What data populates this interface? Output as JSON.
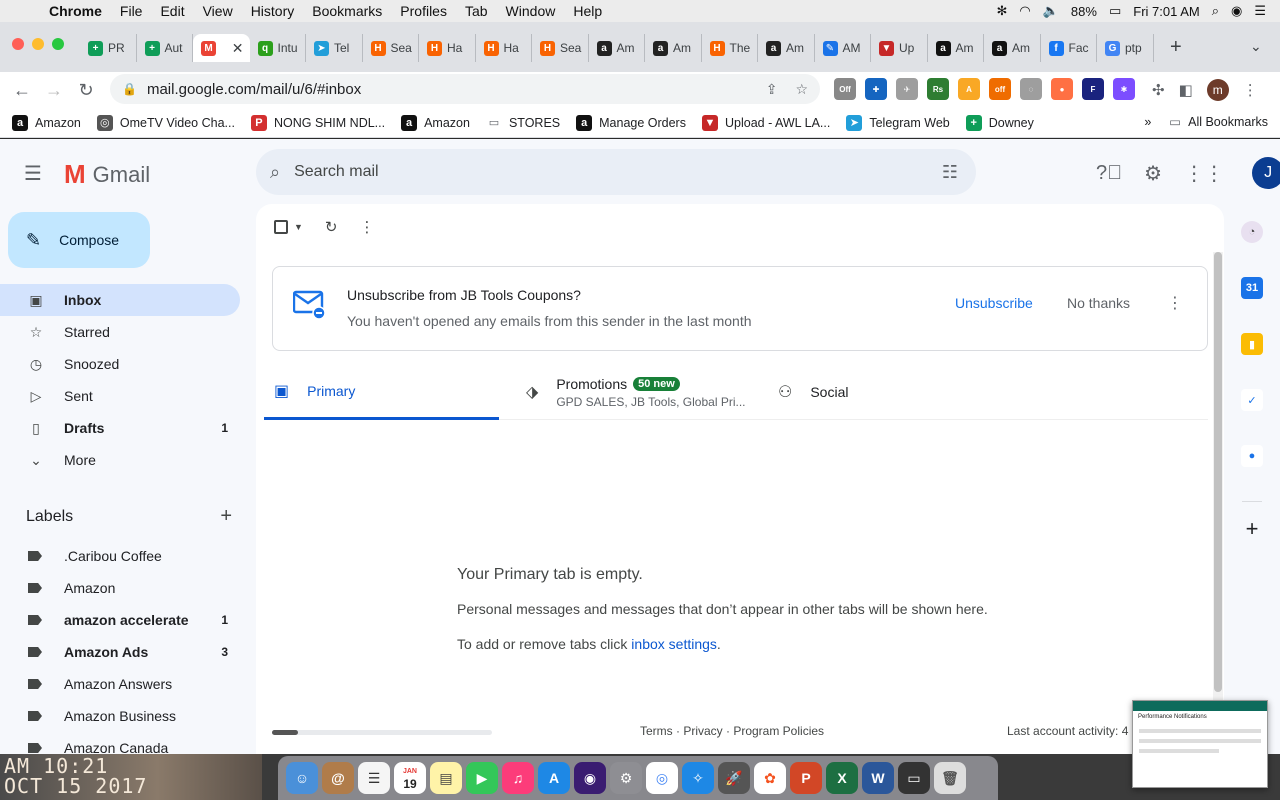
{
  "menubar": {
    "app": "Chrome",
    "items": [
      "File",
      "Edit",
      "View",
      "History",
      "Bookmarks",
      "Profiles",
      "Tab",
      "Window",
      "Help"
    ],
    "battery": "88%",
    "clock": "Fri 7:01 AM"
  },
  "tabs": [
    {
      "label": "PR",
      "color": "#0f9d58",
      "glyph": "+"
    },
    {
      "label": "Aut",
      "color": "#0f9d58",
      "glyph": "+"
    },
    {
      "label": "",
      "color": "#ea4335",
      "glyph": "M",
      "active": true
    },
    {
      "label": "Intu",
      "color": "#2ca01c",
      "glyph": "q"
    },
    {
      "label": "Tel",
      "color": "#229ed9",
      "glyph": "➤"
    },
    {
      "label": "Sea",
      "color": "#f96302",
      "glyph": "H"
    },
    {
      "label": "Ha",
      "color": "#f96302",
      "glyph": "H"
    },
    {
      "label": "Ha",
      "color": "#f96302",
      "glyph": "H"
    },
    {
      "label": "Sea",
      "color": "#f96302",
      "glyph": "H"
    },
    {
      "label": "Am",
      "color": "#222222",
      "glyph": "a"
    },
    {
      "label": "Am",
      "color": "#222222",
      "glyph": "a"
    },
    {
      "label": "The",
      "color": "#f96302",
      "glyph": "H"
    },
    {
      "label": "Am",
      "color": "#222222",
      "glyph": "a"
    },
    {
      "label": "AM",
      "color": "#1a73e8",
      "glyph": "✎"
    },
    {
      "label": "Up",
      "color": "#c62828",
      "glyph": "▼"
    },
    {
      "label": "Am",
      "color": "#111111",
      "glyph": "a"
    },
    {
      "label": "Am",
      "color": "#111111",
      "glyph": "a"
    },
    {
      "label": "Fac",
      "color": "#1877f2",
      "glyph": "f"
    },
    {
      "label": "ptp",
      "color": "#4285f4",
      "glyph": "G"
    }
  ],
  "address": {
    "url": "mail.google.com/mail/u/6/#inbox"
  },
  "extensions": [
    {
      "color": "#888888",
      "glyph": "Off"
    },
    {
      "color": "#1565c0",
      "glyph": "✚"
    },
    {
      "color": "#9e9e9e",
      "glyph": "✈"
    },
    {
      "color": "#2e7d32",
      "glyph": "Rs"
    },
    {
      "color": "#f9a825",
      "glyph": "A"
    },
    {
      "color": "#ef6c00",
      "glyph": "off"
    },
    {
      "color": "#9e9e9e",
      "glyph": "◌"
    },
    {
      "color": "#ff7043",
      "glyph": "●"
    },
    {
      "color": "#1a237e",
      "glyph": "F"
    },
    {
      "color": "#7c4dff",
      "glyph": "✱"
    }
  ],
  "profile_initial": "m",
  "bookmarks": [
    {
      "label": "Amazon",
      "color": "#111111",
      "glyph": "a"
    },
    {
      "label": "OmeTV Video Cha...",
      "color": "#555555",
      "glyph": "◎"
    },
    {
      "label": "NONG SHIM NDL...",
      "color": "#d32f2f",
      "glyph": "P"
    },
    {
      "label": "Amazon",
      "color": "#111111",
      "glyph": "a"
    },
    {
      "label": "STORES",
      "color": "#ffffff",
      "glyph": "▭"
    },
    {
      "label": "Manage Orders",
      "color": "#111111",
      "glyph": "a"
    },
    {
      "label": "Upload - AWL LA...",
      "color": "#c62828",
      "glyph": "▼"
    },
    {
      "label": "Telegram Web",
      "color": "#229ed9",
      "glyph": "➤"
    },
    {
      "label": "Downey",
      "color": "#0f9d58",
      "glyph": "+"
    }
  ],
  "bookmarks_more": "»",
  "all_bookmarks": "All Bookmarks",
  "gmail": {
    "brand": "Gmail",
    "search_placeholder": "Search mail",
    "avatar_initial": "J",
    "compose": "Compose",
    "nav": [
      {
        "label": "Inbox",
        "icon": "▣",
        "count": "",
        "active": true
      },
      {
        "label": "Starred",
        "icon": "☆",
        "count": ""
      },
      {
        "label": "Snoozed",
        "icon": "◷",
        "count": ""
      },
      {
        "label": "Sent",
        "icon": "▷",
        "count": ""
      },
      {
        "label": "Drafts",
        "icon": "▯",
        "count": "1",
        "bold": true
      },
      {
        "label": "More",
        "icon": "⌄",
        "count": ""
      }
    ],
    "labels_title": "Labels",
    "labels": [
      {
        "label": ".Caribou Coffee",
        "count": ""
      },
      {
        "label": "Amazon",
        "count": ""
      },
      {
        "label": "amazon accelerate",
        "count": "1",
        "bold": true
      },
      {
        "label": "Amazon Ads",
        "count": "3",
        "bold": true
      },
      {
        "label": "Amazon Answers",
        "count": ""
      },
      {
        "label": "Amazon Business",
        "count": ""
      },
      {
        "label": "Amazon Canada",
        "count": ""
      }
    ],
    "unsub": {
      "title": "Unsubscribe from JB Tools Coupons?",
      "subtitle": "You haven't opened any emails from this sender in the last month",
      "unsubscribe": "Unsubscribe",
      "no_thanks": "No thanks"
    },
    "tabs": {
      "primary": "Primary",
      "promotions": "Promotions",
      "promotions_badge": "50 new",
      "promotions_sub": "GPD SALES, JB Tools, Global Pri...",
      "social": "Social"
    },
    "empty": {
      "title": "Your Primary tab is empty.",
      "body": "Personal messages and messages that don’t appear in other tabs will be shown here.",
      "settings_prefix": "To add or remove tabs click ",
      "settings_link": "inbox settings",
      "settings_suffix": "."
    },
    "footer": {
      "links": "Terms · Privacy · Program Policies",
      "activity": "Last account activity: 4"
    }
  },
  "photo_overlay": {
    "line1": "AM 10:21",
    "line2": "OCT 15 2017"
  },
  "calendar_day": "19",
  "calendar_month": "JAN",
  "thumbnail_title": "Performance Notifications"
}
